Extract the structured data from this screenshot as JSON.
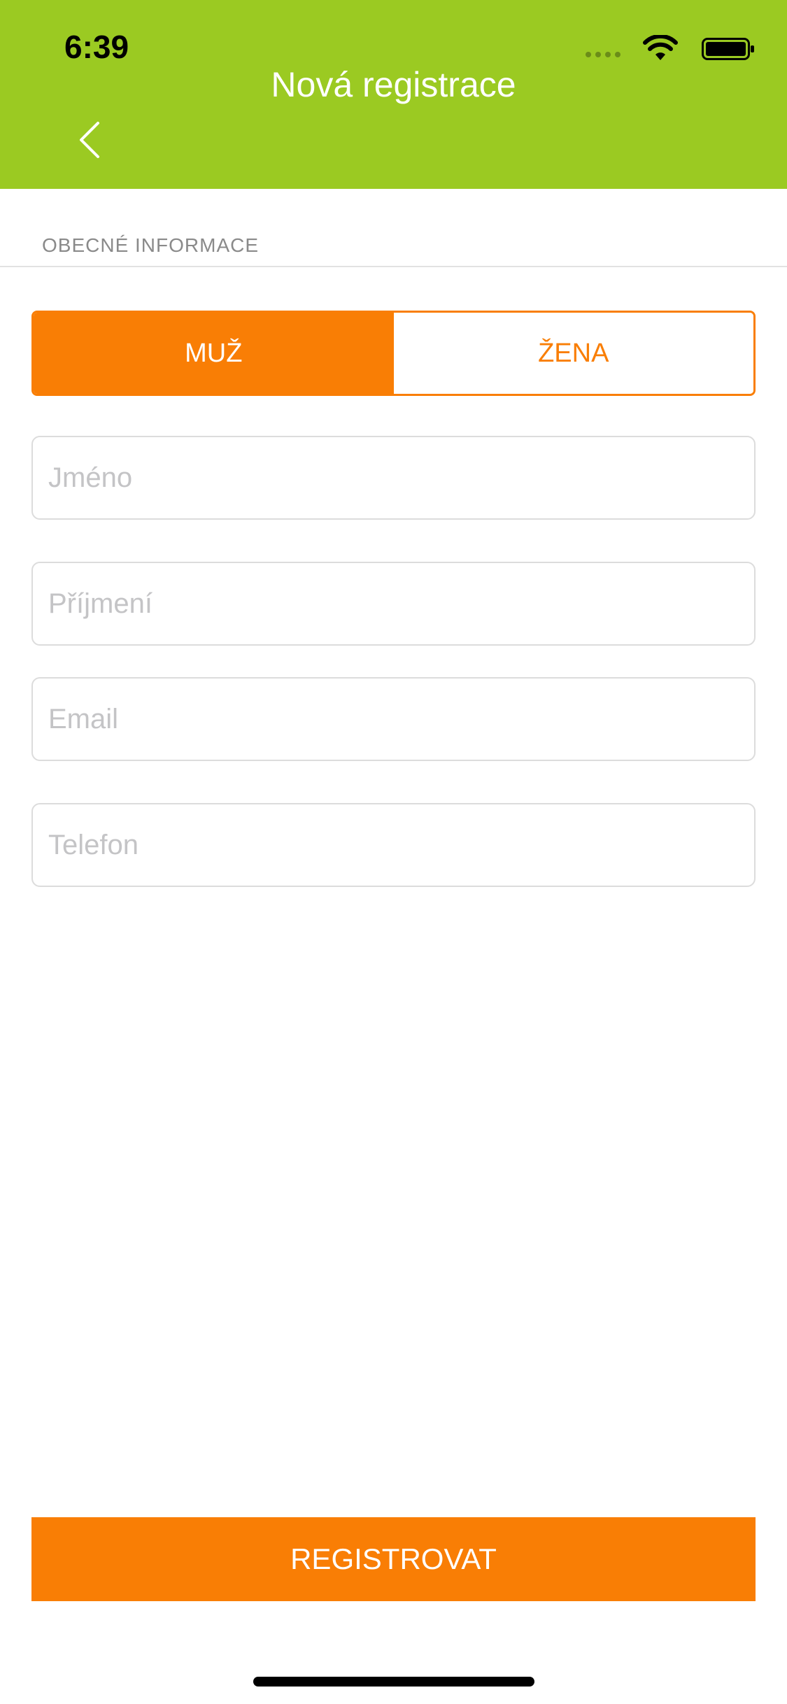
{
  "status_bar": {
    "time": "6:39",
    "icons": [
      "signal-icon",
      "wifi-icon",
      "battery-icon"
    ]
  },
  "header": {
    "title": "Nová registrace",
    "back_icon": "chevron-left-icon",
    "background_color": "#9bca22"
  },
  "section": {
    "title": "OBECNÉ INFORMACE"
  },
  "gender": {
    "options": [
      "MUŽ",
      "ŽENA"
    ],
    "selected": "MUŽ"
  },
  "form": {
    "first_name": {
      "placeholder": "Jméno",
      "value": ""
    },
    "last_name": {
      "placeholder": "Příjmení",
      "value": ""
    },
    "email": {
      "placeholder": "Email",
      "value": ""
    },
    "phone": {
      "placeholder": "Telefon",
      "value": ""
    }
  },
  "actions": {
    "register_label": "REGISTROVAT"
  },
  "colors": {
    "accent": "#f97e05",
    "header": "#9bca22"
  }
}
